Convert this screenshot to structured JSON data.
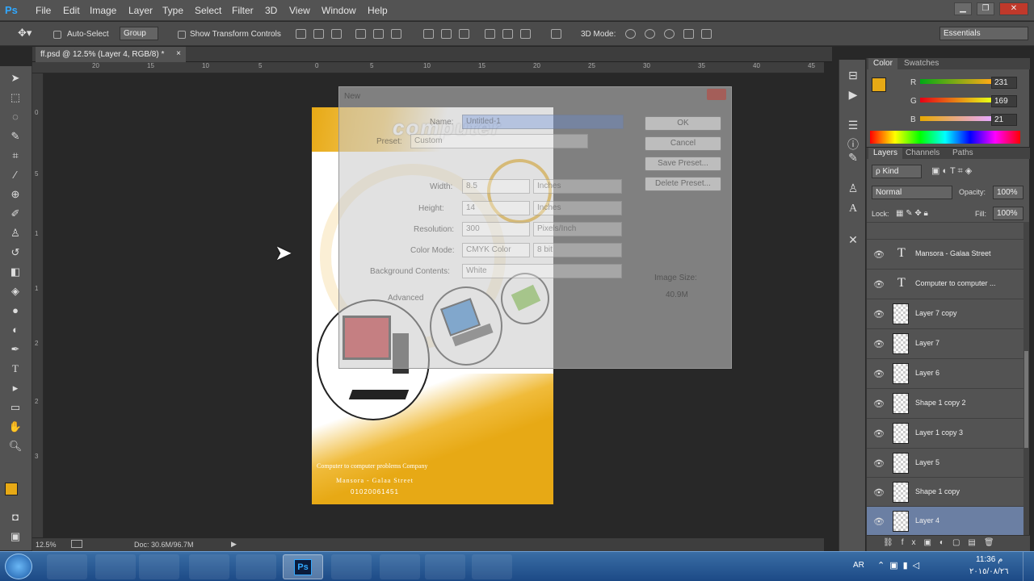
{
  "app": {
    "logo": "Ps"
  },
  "menu": [
    "File",
    "Edit",
    "Image",
    "Layer",
    "Type",
    "Select",
    "Filter",
    "3D",
    "View",
    "Window",
    "Help"
  ],
  "options": {
    "auto_select": "Auto-Select",
    "group": "Group",
    "show_transform": "Show Transform Controls",
    "mode_3d": "3D Mode:",
    "workspace": "Essentials"
  },
  "document": {
    "tab_title": "ff.psd @ 12.5% (Layer 4, RGB/8) *"
  },
  "status": {
    "zoom": "12.5%",
    "doc": "Doc: 30.6M/96.7M"
  },
  "ruler": {
    "h": [
      "20",
      "15",
      "10",
      "5",
      "0",
      "5",
      "10",
      "15",
      "20",
      "25",
      "30",
      "35",
      "40",
      "45"
    ],
    "v": [
      "0",
      "5",
      "1",
      "1",
      "2",
      "2",
      "3"
    ]
  },
  "color_panel": {
    "tabs": [
      "Color",
      "Swatches"
    ],
    "r_label": "R",
    "g_label": "G",
    "b_label": "B",
    "r": "231",
    "g": "169",
    "b": "21",
    "fg_color": "#e7a915"
  },
  "layers_panel": {
    "tabs": [
      "Layers",
      "Channels",
      "Paths"
    ],
    "kind": "Kind",
    "blend": "Normal",
    "opacity_label": "Opacity:",
    "opacity": "100%",
    "lock_label": "Lock:",
    "fill_label": "Fill:",
    "fill": "100%",
    "layers": [
      {
        "name": "Mansora - Galaa Street",
        "type": "text"
      },
      {
        "name": "Computer to computer ...",
        "type": "text"
      },
      {
        "name": "Layer 7 copy",
        "type": "pixel"
      },
      {
        "name": "Layer 7",
        "type": "pixel"
      },
      {
        "name": "Layer 6",
        "type": "pixel"
      },
      {
        "name": "Shape 1 copy 2",
        "type": "pixel"
      },
      {
        "name": "Layer 1 copy 3",
        "type": "pixel"
      },
      {
        "name": "Layer 5",
        "type": "pixel"
      },
      {
        "name": "Shape 1 copy",
        "type": "pixel"
      },
      {
        "name": "Layer 4",
        "type": "pixel",
        "selected": true
      }
    ]
  },
  "dialog": {
    "title": "New",
    "name_label": "Name:",
    "name_value": "Untitled-1",
    "preset_label": "Preset:",
    "preset_value": "Custom",
    "width_label": "Width:",
    "width_value": "8.5",
    "width_unit": "Inches",
    "height_label": "Height:",
    "height_value": "14",
    "height_unit": "Inches",
    "resolution_label": "Resolution:",
    "resolution_value": "300",
    "resolution_unit": "Pixels/Inch",
    "color_mode_label": "Color Mode:",
    "color_mode_value": "CMYK Color",
    "bits_value": "8 bit",
    "bg_label": "Background Contents:",
    "bg_value": "White",
    "advanced_label": "Advanced",
    "ok": "OK",
    "cancel": "Cancel",
    "save_preset": "Save Preset...",
    "delete_preset": "Delete Preset...",
    "image_size_label": "Image Size:",
    "image_size_value": "40.9M"
  },
  "artwork": {
    "title": "computer",
    "line1": "Computer to computer problems Company",
    "line2": "Mansora - Galaa Street",
    "line3": "01020061451",
    "accent": "#e7a915"
  },
  "taskbar": {
    "lang": "AR",
    "time": "11:36 م",
    "date": "٢٠١٥/٠٨/٢٦"
  }
}
